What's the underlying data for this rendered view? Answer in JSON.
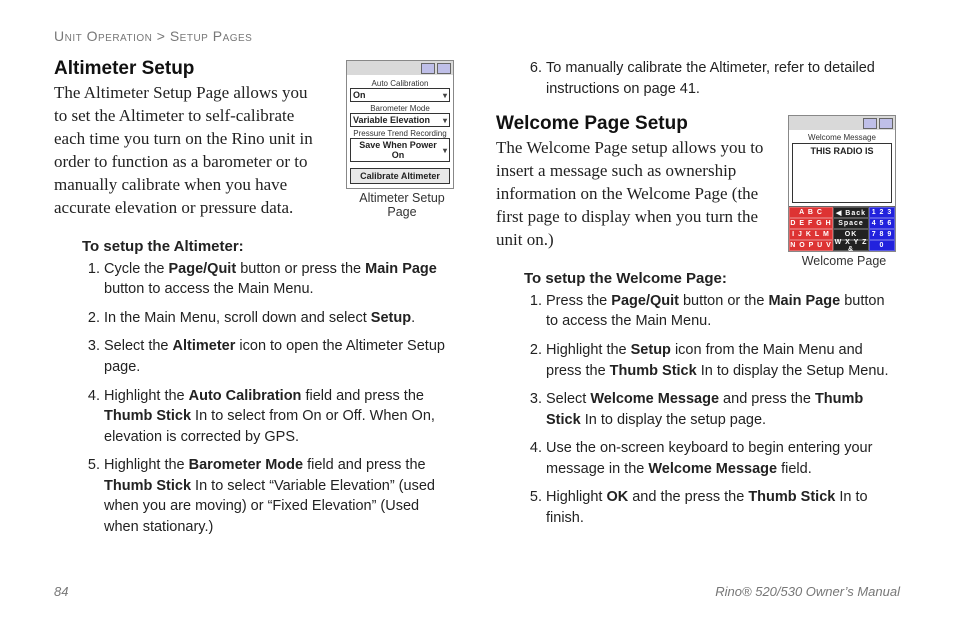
{
  "breadcrumb": "Unit Operation > Setup Pages",
  "left": {
    "heading": "Altimeter Setup",
    "intro": "The Altimeter Setup Page allows you to set the Altimeter to self-calibrate each time you turn on the Rino unit in order to function as a barometer or to manually calibrate when you have accurate elevation or pressure data.",
    "figure": {
      "caption": "Altimeter Setup Page",
      "fields": {
        "auto_cal_label": "Auto Calibration",
        "auto_cal_value": "On",
        "baro_label": "Barometer Mode",
        "baro_value": "Variable Elevation",
        "trend_label": "Pressure Trend Recording",
        "trend_value": "Save When Power On",
        "button": "Calibrate Altimeter"
      }
    },
    "steps_title": "To setup the Altimeter:",
    "steps": [
      "Cycle the <b>Page/Quit</b> button or press the <b>Main Page</b> button to access the Main Menu.",
      "In the Main Menu, scroll down and select <b>Setup</b>.",
      "Select the <b>Altimeter</b> icon to open the Altimeter Setup page.",
      "Highlight the <b>Auto Calibration</b> field and press the <b>Thumb Stick</b> In to select from On or Off. When On, elevation is corrected by GPS.",
      "Highlight the <b>Barometer Mode</b> field and press the <b>Thumb Stick</b> In to select “Variable Elevation” (used when you are moving) or “Fixed Elevation” (Used when stationary.)"
    ]
  },
  "right": {
    "pre_step": "To manually calibrate the Altimeter, refer to detailed instructions on page 41.",
    "heading": "Welcome Page Setup",
    "intro": "The Welcome Page setup allows you to insert a message such as ownership information on the Welcome Page (the first page to display when you turn the unit on.)",
    "figure": {
      "caption": "Welcome Page",
      "label": "Welcome Message",
      "text": "THIS RADIO IS",
      "kbd_left": [
        "A B C",
        "D E F G H",
        "I J K L M",
        "N O P U V"
      ],
      "kbd_mid": [
        "◀ Back",
        "Space",
        "OK",
        "W X Y Z &"
      ],
      "kbd_right": [
        "1 2 3",
        "4 5 6",
        "7 8 9",
        "0"
      ]
    },
    "steps_title": "To setup the Welcome Page:",
    "steps": [
      "Press the <b>Page/Quit</b> button or the <b>Main Page</b> button to access the Main Menu.",
      "Highlight the <b>Setup</b> icon from the Main Menu and press the <b>Thumb Stick</b> In to display the Setup Menu.",
      "Select <b>Welcome Message</b> and press the <b>Thumb Stick</b> In to display the setup page.",
      "Use the on-screen keyboard to begin entering your message in the <b>Welcome Message</b> field.",
      "Highlight <b>OK</b> and the press the <b>Thumb Stick</b> In to finish."
    ]
  },
  "footer": {
    "page": "84",
    "title": "Rino® 520/530 Owner’s Manual"
  }
}
